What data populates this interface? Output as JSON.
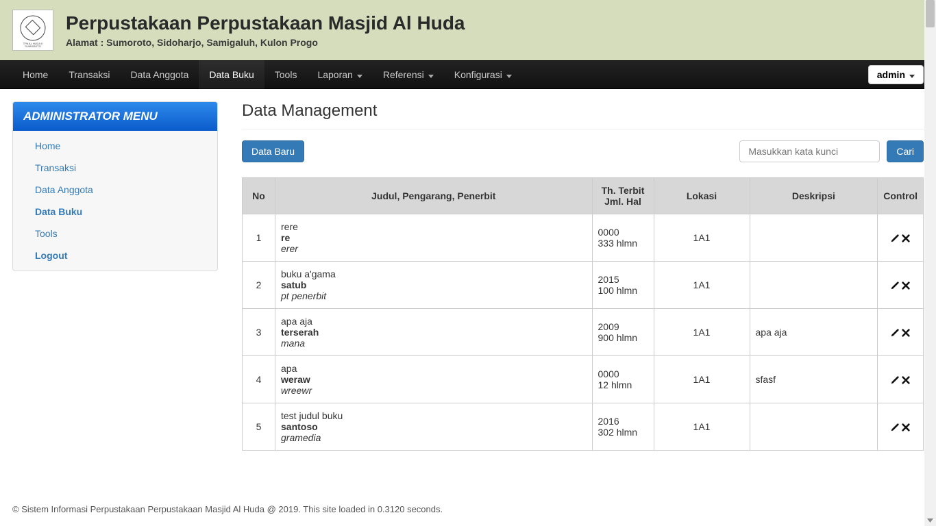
{
  "header": {
    "title": "Perpustakaan Perpustakaan Masjid Al Huda",
    "subtitle": "Alamat : Sumoroto, Sidoharjo, Samigaluh, Kulon Progo"
  },
  "topnav": {
    "items": [
      {
        "label": "Home",
        "dropdown": false,
        "active": false
      },
      {
        "label": "Transaksi",
        "dropdown": false,
        "active": false
      },
      {
        "label": "Data Anggota",
        "dropdown": false,
        "active": false
      },
      {
        "label": "Data Buku",
        "dropdown": false,
        "active": true
      },
      {
        "label": "Tools",
        "dropdown": false,
        "active": false
      },
      {
        "label": "Laporan",
        "dropdown": true,
        "active": false
      },
      {
        "label": "Referensi",
        "dropdown": true,
        "active": false
      },
      {
        "label": "Konfigurasi",
        "dropdown": true,
        "active": false
      }
    ],
    "admin_label": "admin"
  },
  "sidebar": {
    "title": "ADMINISTRATOR MENU",
    "items": [
      {
        "label": "Home",
        "active": false
      },
      {
        "label": "Transaksi",
        "active": false
      },
      {
        "label": "Data Anggota",
        "active": false
      },
      {
        "label": "Data Buku",
        "active": true
      },
      {
        "label": "Tools",
        "active": false
      },
      {
        "label": "Logout",
        "active": true
      }
    ]
  },
  "main": {
    "page_title": "Data Management",
    "new_button": "Data Baru",
    "search_placeholder": "Masukkan kata kunci",
    "search_button": "Cari",
    "table": {
      "headers": {
        "no": "No",
        "judul": "Judul, Pengarang, Penerbit",
        "th_terbit": "Th. Terbit",
        "jml_hal": "Jml. Hal",
        "lokasi": "Lokasi",
        "deskripsi": "Deskripsi",
        "control": "Control"
      },
      "rows": [
        {
          "no": "1",
          "judul": "rere",
          "pengarang": "re",
          "penerbit": "erer",
          "tahun": "0000",
          "hal": "333 hlmn",
          "lokasi": "1A1",
          "deskripsi": ""
        },
        {
          "no": "2",
          "judul": "buku a'gama",
          "pengarang": "satub",
          "penerbit": "pt penerbit",
          "tahun": "2015",
          "hal": "100 hlmn",
          "lokasi": "1A1",
          "deskripsi": ""
        },
        {
          "no": "3",
          "judul": "apa aja",
          "pengarang": "terserah",
          "penerbit": "mana",
          "tahun": "2009",
          "hal": "900 hlmn",
          "lokasi": "1A1",
          "deskripsi": "apa aja"
        },
        {
          "no": "4",
          "judul": "apa",
          "pengarang": "weraw",
          "penerbit": "wreewr",
          "tahun": "0000",
          "hal": "12 hlmn",
          "lokasi": "1A1",
          "deskripsi": "sfasf"
        },
        {
          "no": "5",
          "judul": "test judul buku",
          "pengarang": "santoso",
          "penerbit": "gramedia",
          "tahun": "2016",
          "hal": "302 hlmn",
          "lokasi": "1A1",
          "deskripsi": ""
        }
      ]
    }
  },
  "footer": {
    "text": "© Sistem Informasi Perpustakaan Perpustakaan Masjid Al Huda @ 2019. This site loaded in 0.3120 seconds."
  }
}
